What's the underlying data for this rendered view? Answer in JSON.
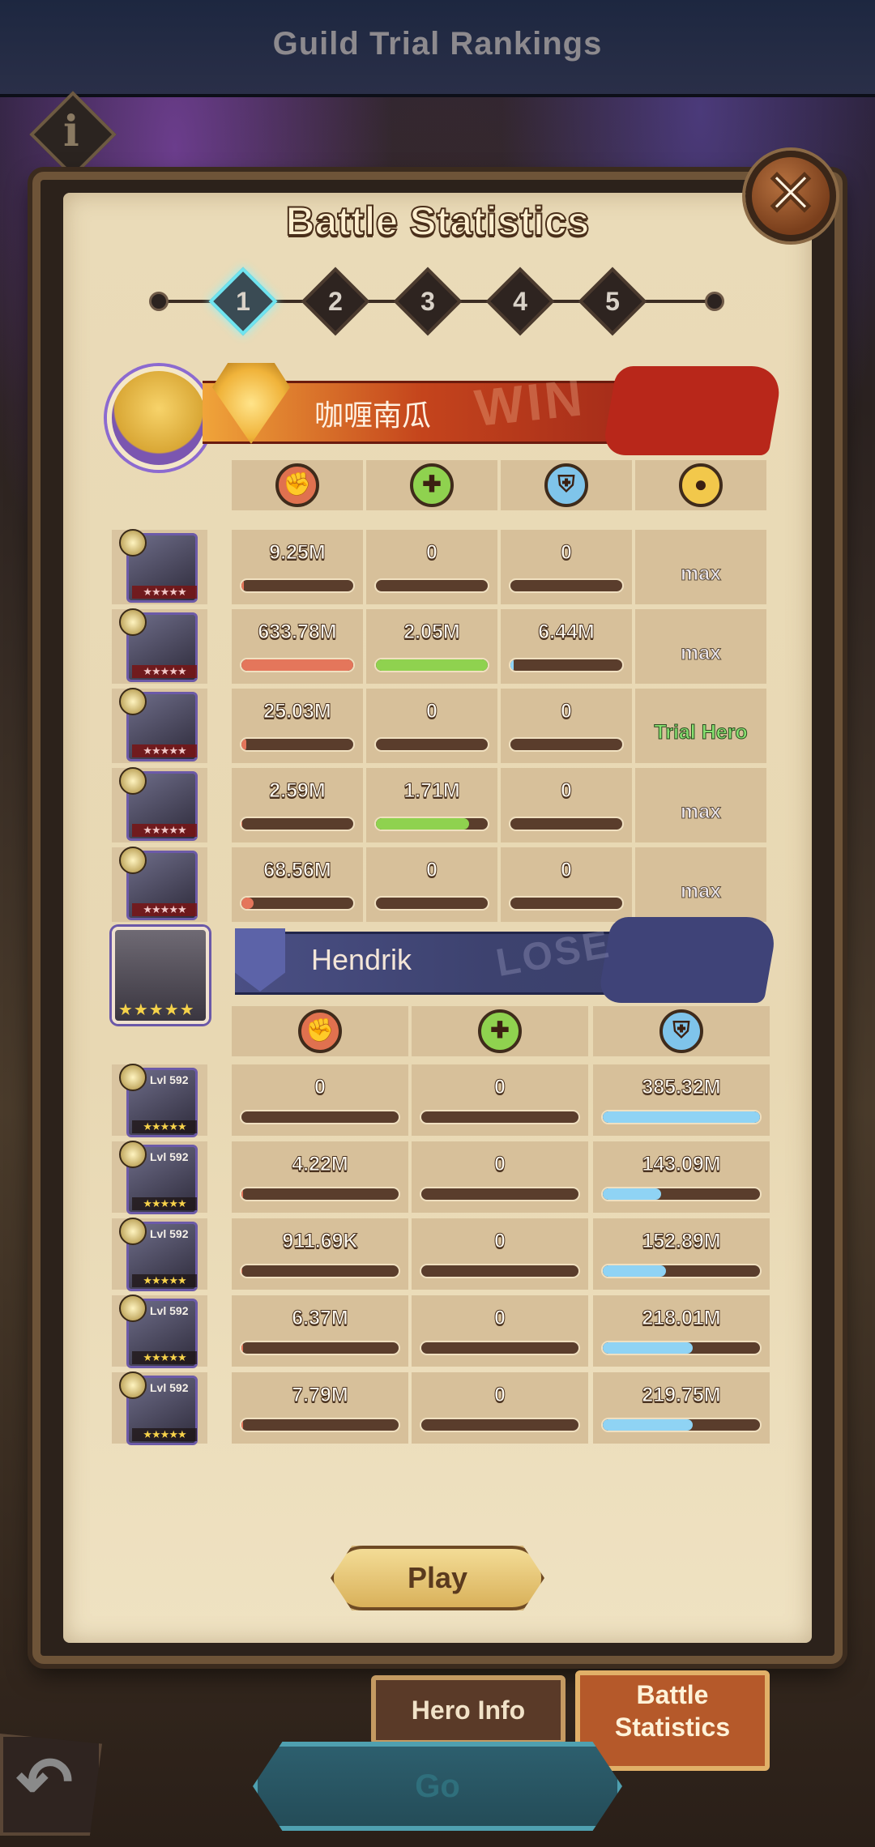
{
  "screen": {
    "top_title": "Guild Trial Rankings",
    "panel_title": "Battle Statistics",
    "close_symbol": "✕",
    "info_symbol": "i"
  },
  "rounds": {
    "active": 1,
    "items": [
      {
        "label": "1"
      },
      {
        "label": "2"
      },
      {
        "label": "3"
      },
      {
        "label": "4"
      },
      {
        "label": "5"
      }
    ]
  },
  "winner": {
    "name": "咖喱南瓜",
    "result_stamp": "WIN",
    "stat_icons": [
      "damage-icon",
      "healing-icon",
      "shield-icon",
      "energy-icon"
    ],
    "heroes": [
      {
        "damage": "9.25M",
        "damage_pct": 0.02,
        "healing": "0",
        "healing_pct": 0,
        "shield": "0",
        "shield_pct": 0,
        "note": "max",
        "trial": false
      },
      {
        "damage": "633.78M",
        "damage_pct": 1.0,
        "healing": "2.05M",
        "healing_pct": 1.0,
        "shield": "6.44M",
        "shield_pct": 0.03,
        "note": "max",
        "trial": false
      },
      {
        "damage": "25.03M",
        "damage_pct": 0.04,
        "healing": "0",
        "healing_pct": 0,
        "shield": "0",
        "shield_pct": 0,
        "note": "Trial Hero",
        "trial": true
      },
      {
        "damage": "2.59M",
        "damage_pct": 0.01,
        "healing": "1.71M",
        "healing_pct": 0.83,
        "shield": "0",
        "shield_pct": 0,
        "note": "max",
        "trial": false
      },
      {
        "damage": "68.56M",
        "damage_pct": 0.11,
        "healing": "0",
        "healing_pct": 0,
        "shield": "0",
        "shield_pct": 0,
        "note": "max",
        "trial": false
      }
    ]
  },
  "loser": {
    "name": "Hendrik",
    "result_stamp": "LOSE",
    "stars": "★★★★★",
    "stat_icons": [
      "damage-icon",
      "healing-icon",
      "shield-icon"
    ],
    "heroes": [
      {
        "level": "Lvl 592",
        "damage": "0",
        "damage_pct": 0,
        "healing": "0",
        "healing_pct": 0,
        "shield": "385.32M",
        "shield_pct": 1.0
      },
      {
        "level": "Lvl 592",
        "damage": "4.22M",
        "damage_pct": 0.01,
        "healing": "0",
        "healing_pct": 0,
        "shield": "143.09M",
        "shield_pct": 0.37
      },
      {
        "level": "Lvl 592",
        "damage": "911.69K",
        "damage_pct": 0.005,
        "healing": "0",
        "healing_pct": 0,
        "shield": "152.89M",
        "shield_pct": 0.4
      },
      {
        "level": "Lvl 592",
        "damage": "6.37M",
        "damage_pct": 0.01,
        "healing": "0",
        "healing_pct": 0,
        "shield": "218.01M",
        "shield_pct": 0.57
      },
      {
        "level": "Lvl 592",
        "damage": "7.79M",
        "damage_pct": 0.01,
        "healing": "0",
        "healing_pct": 0,
        "shield": "219.75M",
        "shield_pct": 0.57
      }
    ]
  },
  "buttons": {
    "play": "Play",
    "hero_info": "Hero Info",
    "battle_stats_line1": "Battle",
    "battle_stats_line2": "Statistics",
    "go": "Go"
  },
  "colors": {
    "damage_bar": "#e4765b",
    "healing_bar": "#8fd24f",
    "shield_bar": "#8fd3f4",
    "active_round": "#6fe4f0"
  }
}
